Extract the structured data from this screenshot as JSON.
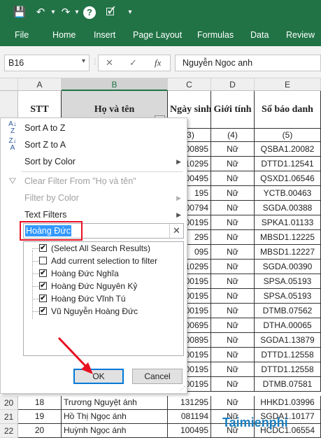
{
  "quick_access": {
    "save": "💾",
    "undo": "↶",
    "undo_dd": "▾",
    "redo": "↷",
    "redo_dd": "▾",
    "help": "?",
    "extra": "🗹",
    "dd": "▾"
  },
  "ribbon": {
    "tabs": [
      "File",
      "Home",
      "Insert",
      "Page Layout",
      "Formulas",
      "Data",
      "Review"
    ]
  },
  "formula_bar": {
    "name_box": "B16",
    "cancel": "✕",
    "enter": "✓",
    "fx": "fx",
    "value": "Nguyễn Ngoc anh"
  },
  "columns": [
    "A",
    "B",
    "C",
    "D",
    "E"
  ],
  "header_row": {
    "row_num": "1",
    "stt": "STT",
    "name": "Họ và tên",
    "dob": "Ngày sinh",
    "gender": "Giới tính",
    "sbd": "Số báo danh"
  },
  "sub_row": {
    "row_num": "",
    "dob": "(3)",
    "gender": "(4)",
    "sbd": "(5)"
  },
  "data_rows": [
    {
      "dob": "00895",
      "gender": "Nữ",
      "sbd": "QSBA1.20082"
    },
    {
      "dob": "10295",
      "gender": "Nữ",
      "sbd": "DTTD1.12541"
    },
    {
      "dob": "00495",
      "gender": "Nữ",
      "sbd": "QSXD1.06546"
    },
    {
      "dob": "195",
      "gender": "Nữ",
      "sbd": "YCTB.00463"
    },
    {
      "dob": "00794",
      "gender": "Nữ",
      "sbd": "SGDA.00388"
    },
    {
      "dob": "00195",
      "gender": "Nữ",
      "sbd": "SPKA1.01133"
    },
    {
      "dob": "295",
      "gender": "Nữ",
      "sbd": "MBSD1.12225"
    },
    {
      "dob": "095",
      "gender": "Nữ",
      "sbd": "MBSD1.12227"
    },
    {
      "dob": "10295",
      "gender": "Nữ",
      "sbd": "SGDA.00390"
    },
    {
      "dob": "00195",
      "gender": "Nữ",
      "sbd": "SPSA.05193"
    },
    {
      "dob": "00195",
      "gender": "Nữ",
      "sbd": "SPSA.05193"
    },
    {
      "dob": "00195",
      "gender": "Nữ",
      "sbd": "DTMB.07562"
    },
    {
      "dob": "00695",
      "gender": "Nữ",
      "sbd": "DTHA.00065"
    },
    {
      "dob": "00895",
      "gender": "Nữ",
      "sbd": "SGDA1.13879"
    },
    {
      "dob": "00195",
      "gender": "Nữ",
      "sbd": "DTTD1.12558"
    },
    {
      "dob": "00195",
      "gender": "Nữ",
      "sbd": "DTTD1.12558"
    },
    {
      "dob": "00195",
      "gender": "Nữ",
      "sbd": "DTMB.07581"
    }
  ],
  "bottom_rows": [
    {
      "row_num": "20",
      "stt": "18",
      "name": "Trương Nguyệt ánh",
      "dob": "131295",
      "gender": "Nữ",
      "sbd": "HHKD1.03996"
    },
    {
      "row_num": "21",
      "stt": "19",
      "name": "Hồ Thị Ngọc ánh",
      "dob": "081194",
      "gender": "Nữ",
      "sbd": "SGDA1.10177"
    },
    {
      "row_num": "22",
      "stt": "20",
      "name": "Huỳnh Ngọc ánh",
      "dob": "100495",
      "gender": "Nữ",
      "sbd": "HCDC1.06554"
    }
  ],
  "filter_menu": {
    "sort_az": "Sort A to Z",
    "sort_za": "Sort Z to A",
    "sort_color": "Sort by Color",
    "clear_filter": "Clear Filter From \"Họ và tên\"",
    "filter_color": "Filter by Color",
    "text_filters": "Text Filters",
    "search_value": "Hoàng Đức",
    "clear_search": "✕",
    "list": [
      {
        "label": "(Select All Search Results)",
        "checked": "✔"
      },
      {
        "label": "Add current selection to filter",
        "checked": ""
      },
      {
        "label": "Hoàng Đức Nghĩa",
        "checked": "✔"
      },
      {
        "label": "Hoàng Đức Nguyên Kỷ",
        "checked": "✔"
      },
      {
        "label": "Hoàng Đức Vĩnh Tú",
        "checked": "✔"
      },
      {
        "label": "Vũ Nguyễn Hoàng Đức",
        "checked": "✔"
      }
    ],
    "ok": "OK",
    "cancel": "Cancel",
    "submenu_arrow": "▶"
  },
  "watermark": "Taimienphi",
  "colors": {
    "excel_green": "#217346",
    "highlight_red": "#e81123",
    "selection_blue": "#3399ff"
  }
}
